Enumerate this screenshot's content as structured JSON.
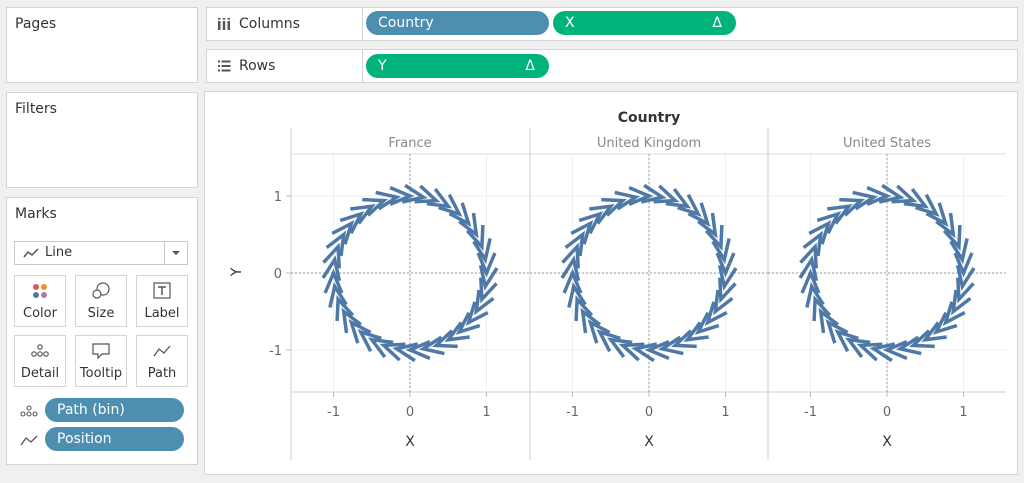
{
  "panels": {
    "pages": "Pages",
    "filters": "Filters",
    "marks": "Marks"
  },
  "marks": {
    "type": "Line",
    "buttons": [
      "Color",
      "Size",
      "Label",
      "Detail",
      "Tooltip",
      "Path"
    ],
    "fields": [
      {
        "name": "Path (bin)",
        "icon": "detail-dots-icon"
      },
      {
        "name": "Position",
        "icon": "path-line-icon"
      }
    ]
  },
  "shelves": {
    "columns": {
      "label": "Columns",
      "pills": [
        {
          "text": "Country",
          "color": "#4e8eb1"
        },
        {
          "text": "X",
          "delta": "Δ",
          "color": "#00b27c"
        }
      ]
    },
    "rows": {
      "label": "Rows",
      "pills": [
        {
          "text": "Y",
          "delta": "Δ",
          "color": "#00b27c"
        }
      ]
    }
  },
  "chart_data": {
    "type": "line",
    "title": "Country",
    "panels": [
      "France",
      "United Kingdom",
      "United States"
    ],
    "xlabel": "X",
    "ylabel": "Y",
    "xticks": [
      -1,
      0,
      1
    ],
    "yticks": [
      1,
      0,
      -1
    ],
    "xlim": [
      -1.5,
      1.5
    ],
    "ylim": [
      -1.55,
      1.55
    ],
    "series_color": "#4e79a7",
    "marks": "36 chevron arrows arranged clockwise on a unit circle"
  }
}
